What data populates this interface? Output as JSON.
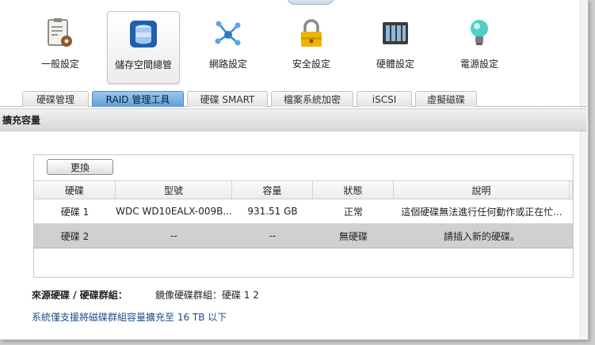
{
  "toolbar": {
    "items": [
      {
        "label": "一般設定",
        "icon": "clipboard-gear-icon"
      },
      {
        "label": "儲存空間總管",
        "icon": "database-icon"
      },
      {
        "label": "網路設定",
        "icon": "network-icon"
      },
      {
        "label": "安全設定",
        "icon": "lock-icon"
      },
      {
        "label": "硬體設定",
        "icon": "hardware-icon"
      },
      {
        "label": "電源設定",
        "icon": "bulb-icon"
      }
    ]
  },
  "tabs": [
    {
      "label": "硬碟管理"
    },
    {
      "label": "RAID 管理工具"
    },
    {
      "label": "硬碟 SMART"
    },
    {
      "label": "檔案系統加密"
    },
    {
      "label": "iSCSI"
    },
    {
      "label": "虛擬磁碟"
    }
  ],
  "section": {
    "title": "擴充容量"
  },
  "panel": {
    "replace_button": "更換",
    "columns": [
      "硬碟",
      "型號",
      "容量",
      "狀態",
      "說明"
    ],
    "rows": [
      [
        "硬碟 1",
        "WDC WD10EALX-009B...",
        "931.51 GB",
        "正常",
        "這個硬碟無法進行任何動作或正在忙..."
      ],
      [
        "硬碟 2",
        "--",
        "--",
        "無硬碟",
        "請插入新的硬碟。"
      ]
    ]
  },
  "info": {
    "label": "來源硬碟 / 硬碟群組：",
    "value": "鏡像硬碟群組：硬碟 1 2"
  },
  "note": "系統僅支援將磁碟群組容量擴充至 16 TB 以下",
  "colors": {
    "active_tab": "#5f9fd8",
    "selected_row": "#d0d0d0",
    "note_text": "#1b4f8a"
  }
}
